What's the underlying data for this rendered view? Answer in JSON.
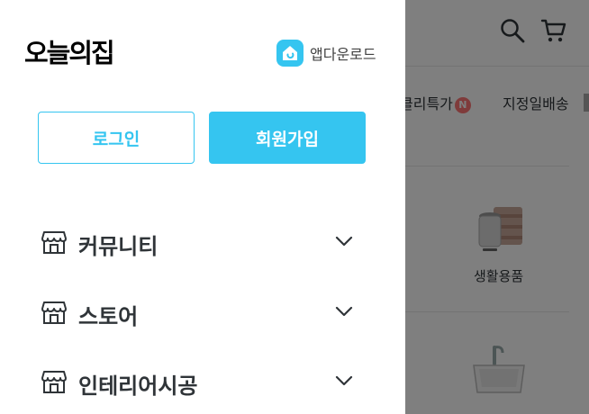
{
  "drawer": {
    "logo": "오늘의집",
    "app_download": {
      "label": "앱다운로드",
      "icon": "home-app-icon",
      "color": "#35c5f0"
    },
    "buttons": {
      "login": "로그인",
      "signup": "회원가입"
    },
    "menu": [
      {
        "label": "커뮤니티",
        "icon": "store-icon"
      },
      {
        "label": "스토어",
        "icon": "store-icon"
      },
      {
        "label": "인테리어시공",
        "icon": "store-icon"
      }
    ],
    "accent_color": "#35c5f0"
  },
  "background_page": {
    "header_icons": [
      "search-icon",
      "cart-icon"
    ],
    "nav": [
      {
        "label": "클리특가",
        "badge": "N"
      },
      {
        "label": "지정일배송"
      }
    ],
    "categories": [
      {
        "label": "생활용품"
      },
      {
        "label": ""
      }
    ]
  }
}
